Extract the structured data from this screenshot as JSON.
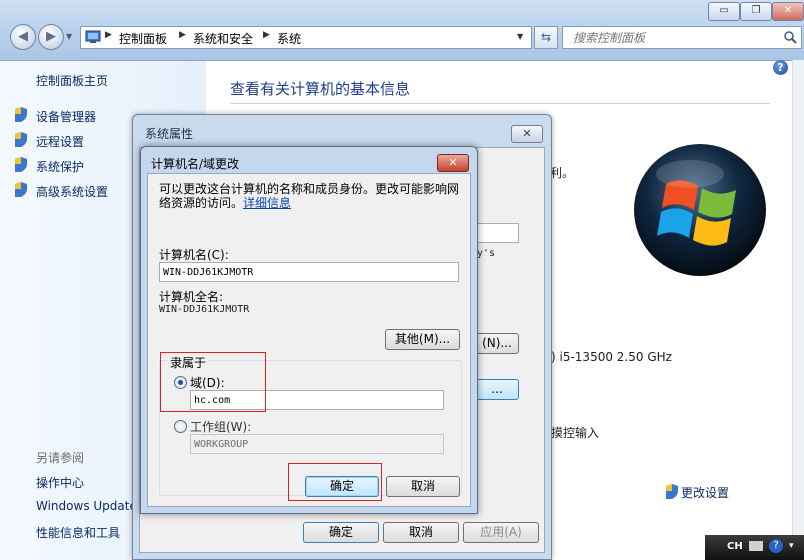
{
  "window": {
    "caption_buttons": {
      "minimize": "▭",
      "maximize": "❐",
      "close": "✕"
    },
    "nav": {
      "back": "◀",
      "forward": "▶"
    },
    "breadcrumbs": [
      "控制面板",
      "系统和安全",
      "系统"
    ],
    "search_placeholder": "搜索控制面板",
    "help": "?"
  },
  "sidebar": {
    "home": "控制面板主页",
    "items": [
      "设备管理器",
      "远程设置",
      "系统保护",
      "高级系统设置"
    ],
    "see_also_header": "另请参阅",
    "see_also": [
      "操作中心",
      "Windows Update",
      "性能信息和工具"
    ]
  },
  "main": {
    "title": "查看有关计算机的基本信息",
    "partial_texts": {
      "rights": "利。",
      "win": "y's",
      "cpu": ") i5-13500   2.50 GHz",
      "touch": "摸控输入"
    },
    "change_settings": "更改设置"
  },
  "system_properties": {
    "title": "系统属性",
    "change_btn": "(N)...",
    "other_btn": "...",
    "buttons": {
      "ok": "确定",
      "cancel": "取消",
      "apply": "应用(A)"
    }
  },
  "computer_name_dialog": {
    "title": "计算机名/域更改",
    "description": "可以更改这台计算机的名称和成员身份。更改可能影响网络资源的访问。",
    "details_link": "详细信息",
    "computer_name_label": "计算机名(C):",
    "computer_name_value": "WIN-DDJ61KJMOTR",
    "full_name_label": "计算机全名:",
    "full_name_value": "WIN-DDJ61KJMOTR",
    "other_button": "其他(M)...",
    "member_of_label": "隶属于",
    "domain_label": "域(D):",
    "domain_value": "hc.com",
    "workgroup_label": "工作组(W):",
    "workgroup_value": "WORKGROUP",
    "selected": "domain",
    "ok": "确定",
    "cancel": "取消"
  },
  "taskbar": {
    "lang": "CH"
  },
  "colors": {
    "link": "#0c2a66",
    "title": "#1e3d8a",
    "highlight": "#e0202a"
  }
}
